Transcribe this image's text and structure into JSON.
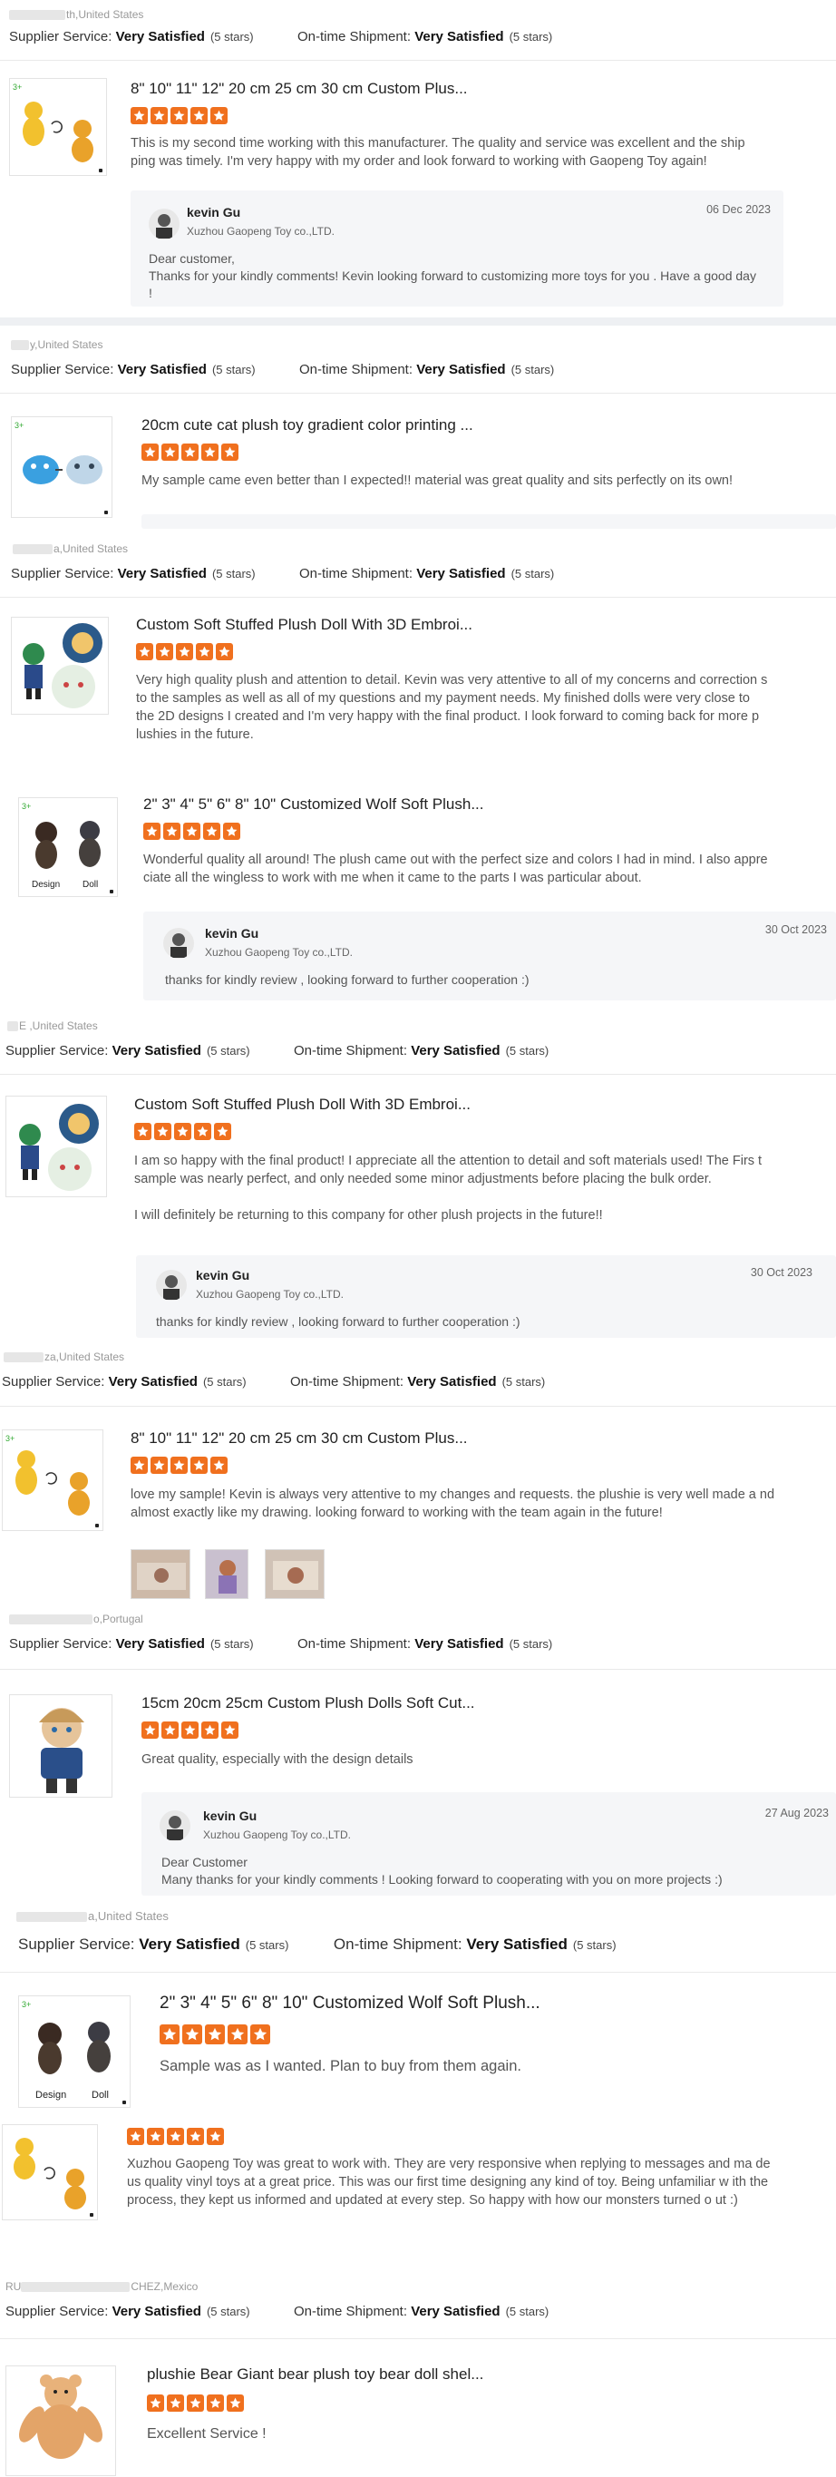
{
  "labels": {
    "supplier_service": "Supplier Service:",
    "ontime_shipment": "On-time Shipment:",
    "satisfied": "Very Satisfied",
    "five_stars": "(5 stars)"
  },
  "colors": {
    "star": "#f0701e",
    "reply_bg": "#f5f6f8",
    "separator": "#eef0f3"
  },
  "reviews": [
    {
      "buyer": "th,United States",
      "product": "8\" 10\" 11\" 12\" 20 cm 25 cm 30 cm Custom Plus...",
      "comment": "This is my second time working with this manufacturer. The quality and service was excellent and the ship ping was timely. I'm very happy with my order and look forward to working with Gaopeng Toy again!",
      "reply": {
        "name": "kevin Gu",
        "company": "Xuzhou Gaopeng Toy co.,LTD.",
        "date": "06 Dec 2023",
        "text": "Dear  customer,\nThanks for your kindly comments!  Kevin looking forward to customizing more toys for you . Have a good day !"
      }
    },
    {
      "buyer": "y,United States",
      "product": "20cm cute cat plush toy gradient color printing ...",
      "comment": "My sample came even better than I expected!! material was great quality and sits perfectly on its own!"
    },
    {
      "buyer": "a,United States",
      "products": [
        {
          "product": "Custom Soft Stuffed Plush Doll With 3D Embroi...",
          "comment": "Very high quality plush and attention to detail. Kevin was very attentive to all of my concerns and correction s to the samples as well as all of my questions and my payment needs. My finished dolls were very close to the 2D designs I created and I'm very happy with the final product. I look forward to coming back for more p lushies in the future."
        },
        {
          "product": "2\" 3\" 4\" 5\" 6\" 8\" 10\" Customized Wolf Soft Plush...",
          "comment": "Wonderful quality all around! The plush came out with the perfect size and colors I had in mind. I also appre ciate all the wingless to work with me when it came to the parts I was particular about."
        }
      ],
      "reply": {
        "name": "kevin Gu",
        "company": "Xuzhou Gaopeng Toy co.,LTD.",
        "date": "30 Oct 2023",
        "text": "thanks for kindly review , looking forward to further cooperation :)"
      }
    },
    {
      "buyer": "E ,United States",
      "product": "Custom Soft Stuffed Plush Doll With 3D Embroi...",
      "comment": "I am so happy with the final product! I appreciate all the attention to detail and soft materials used! The Firs t sample was nearly perfect, and only needed some minor adjustments before placing the bulk order.\n\nI will definitely be returning to this company for other plush projects in the future!!",
      "reply": {
        "name": "kevin Gu",
        "company": "Xuzhou Gaopeng Toy co.,LTD.",
        "date": "30 Oct 2023",
        "text": "thanks for kindly review , looking forward to further cooperation :)"
      }
    },
    {
      "buyer": "za,United States",
      "product": "8\" 10\" 11\" 12\" 20 cm 25 cm 30 cm Custom Plus...",
      "comment": "love my sample! Kevin is always very attentive to my changes and requests. the plushie is very well made a nd almost exactly like my drawing. looking forward to working with the team again in the future!"
    },
    {
      "buyer": "o,Portugal",
      "product": "15cm 20cm 25cm Custom Plush Dolls Soft Cut...",
      "comment": "Great quality, especially with the design details",
      "reply": {
        "name": "kevin Gu",
        "company": "Xuzhou Gaopeng Toy co.,LTD.",
        "date": "27 Aug 2023",
        "text": "Dear Customer\nMany thanks for your kindly comments ! Looking forward to cooperating with you on more projects :)"
      }
    },
    {
      "buyer": "a,United States",
      "product": "2\" 3\" 4\" 5\" 6\" 8\" 10\" Customized Wolf Soft Plush...",
      "comment": "Sample was as I wanted. Plan to buy from them again."
    },
    {
      "comment": "Xuzhou Gaopeng Toy was great to work with. They are very responsive when replying to messages and ma de us quality vinyl toys at a great price. This was our first time designing any kind of toy. Being unfamiliar w ith the process, they kept us informed and updated at every step. So happy with how our monsters turned o ut :)"
    },
    {
      "buyer": "CHEZ,Mexico",
      "product": "plushie Bear Giant bear plush toy bear doll shel...",
      "comment": "Excellent Service !"
    }
  ]
}
